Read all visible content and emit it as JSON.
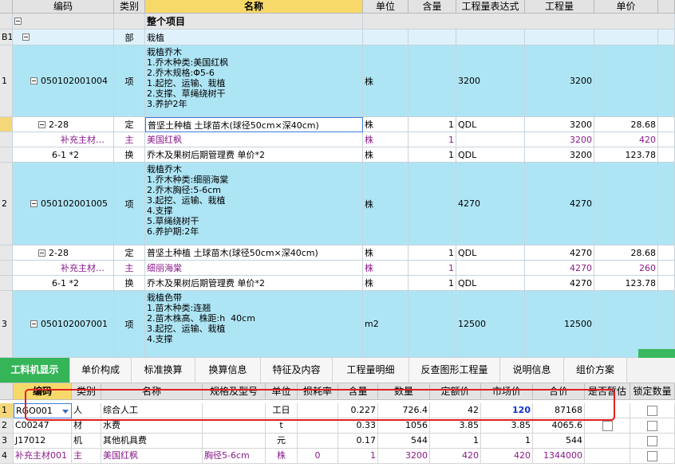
{
  "top_grid": {
    "headers": [
      "编码",
      "类别",
      "名称",
      "单位",
      "含量",
      "工程量表达式",
      "工程量",
      "单价"
    ],
    "rows": [
      {
        "no": "",
        "code": "",
        "type": "",
        "name": "整个项目",
        "unit": "",
        "content": "",
        "expr": "",
        "qty": "",
        "price": ""
      },
      {
        "no": "B1",
        "code": "",
        "type": "部",
        "name": "栽植",
        "unit": "",
        "content": "",
        "expr": "",
        "qty": "",
        "price": ""
      },
      {
        "no": "1",
        "code": "050102001004",
        "type": "项",
        "name": "栽植乔木\n1.乔木种类:美国红枫\n2.乔木规格:Φ5-6\n1.起挖、运输、栽植\n2.支撑、草绳绕树干\n3.养护2年",
        "unit": "株",
        "content": "",
        "expr": "3200",
        "qty": "3200",
        "price": ""
      },
      {
        "no": "",
        "code": "2-28",
        "type": "定",
        "name": "普坚土种植 土球苗木(球径50cm×深40cm)",
        "unit": "株",
        "content": "1",
        "expr": "QDL",
        "qty": "3200",
        "price": "28.68"
      },
      {
        "no": "",
        "code": "补充主材…",
        "type": "主",
        "name": "美国红枫",
        "unit": "株",
        "content": "1",
        "expr": "",
        "qty": "3200",
        "price": "420"
      },
      {
        "no": "",
        "code": "6-1 *2",
        "type": "换",
        "name": "乔木及果树后期管理费  单价*2",
        "unit": "株",
        "content": "1",
        "expr": "QDL",
        "qty": "3200",
        "price": "123.78"
      },
      {
        "no": "2",
        "code": "050102001005",
        "type": "项",
        "name": "栽植乔木\n1.乔木种类:细丽海棠\n2.乔木胸径:5-6cm\n3.起挖、运输、栽植\n4.支撑\n5.草绳绕树干\n6.养护期:2年",
        "unit": "株",
        "content": "",
        "expr": "4270",
        "qty": "4270",
        "price": ""
      },
      {
        "no": "",
        "code": "2-28",
        "type": "定",
        "name": "普坚土种植 土球苗木(球径50cm×深40cm)",
        "unit": "株",
        "content": "1",
        "expr": "QDL",
        "qty": "4270",
        "price": "28.68"
      },
      {
        "no": "",
        "code": "补充主材…",
        "type": "主",
        "name": "细丽海棠",
        "unit": "株",
        "content": "1",
        "expr": "",
        "qty": "4270",
        "price": "260"
      },
      {
        "no": "",
        "code": "6-1 *2",
        "type": "换",
        "name": "乔木及果树后期管理费  单价*2",
        "unit": "株",
        "content": "1",
        "expr": "QDL",
        "qty": "4270",
        "price": "123.78"
      },
      {
        "no": "3",
        "code": "050102007001",
        "type": "项",
        "name": "栽植色带\n1.苗木种类:连翘\n2.苗木株高、株距:h  40cm\n3.起挖、运输、栽植\n4.支撑",
        "unit": "m2",
        "content": "",
        "expr": "12500",
        "qty": "12500",
        "price": ""
      }
    ]
  },
  "tabs": [
    "工料机显示",
    "单价构成",
    "标准换算",
    "换算信息",
    "特征及内容",
    "工程量明细",
    "反查图形工程量",
    "说明信息",
    "组价方案"
  ],
  "active_tab": "工料机显示",
  "bottom_grid": {
    "headers": [
      "编码",
      "类别",
      "名称",
      "规格及型号",
      "单位",
      "损耗率",
      "含量",
      "数量",
      "定额价",
      "市场价",
      "合价",
      "是否暂估",
      "锁定数量"
    ],
    "rows": [
      {
        "no": "1",
        "code": "RGO001",
        "type": "人",
        "name": "综合人工",
        "spec": "",
        "unit": "工日",
        "loss": "",
        "content": "0.227",
        "qty": "726.4",
        "base": "42",
        "market": "120",
        "total": "87168"
      },
      {
        "no": "2",
        "code": "C00247",
        "type": "材",
        "name": "水费",
        "spec": "",
        "unit": "t",
        "loss": "",
        "content": "0.33",
        "qty": "1056",
        "base": "3.85",
        "market": "3.85",
        "total": "4065.6"
      },
      {
        "no": "3",
        "code": "J17012",
        "type": "机",
        "name": "其他机具费",
        "spec": "",
        "unit": "元",
        "loss": "",
        "content": "0.17",
        "qty": "544",
        "base": "1",
        "market": "1",
        "total": "544"
      },
      {
        "no": "4",
        "code": "补充主材001",
        "type": "主",
        "name": "美国红枫",
        "spec": "胸径5-6cm",
        "unit": "株",
        "loss": "0",
        "content": "1",
        "qty": "3200",
        "base": "420",
        "market": "420",
        "total": "1344000"
      }
    ]
  },
  "colors": {
    "accent": "#35b558",
    "highlight_row": "#aee5f5",
    "header_selected": "#f7d96a",
    "annotation": "#e02020",
    "market_price_blue": "#1030d0",
    "main_material": "#8a1a8a"
  }
}
